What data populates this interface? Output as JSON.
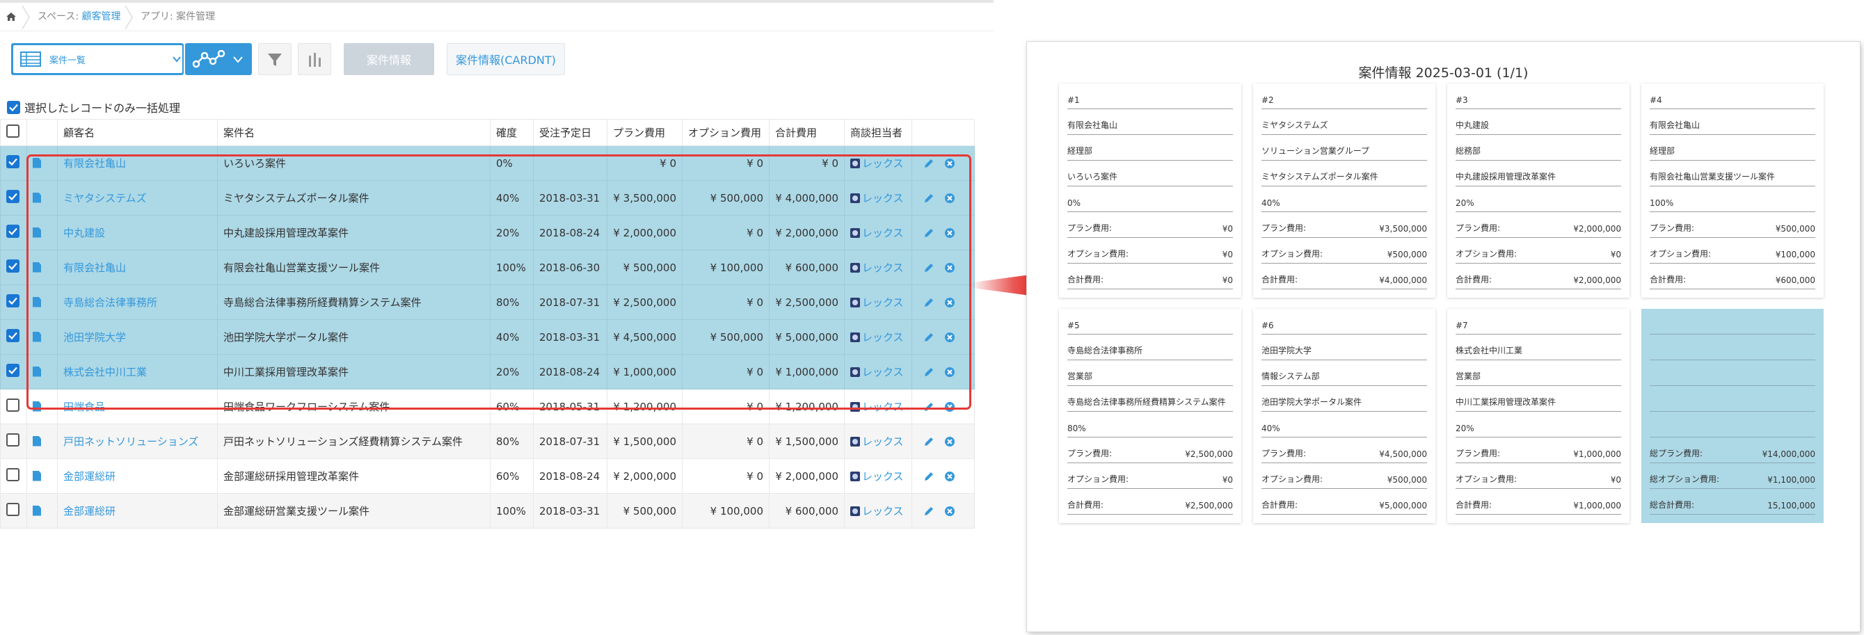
{
  "breadcrumb": {
    "space_prefix": "スペース: ",
    "space_name": "顧客管理",
    "app": "アプリ: 案件管理"
  },
  "toolbar": {
    "view_name": "案件一覧",
    "print_button": "案件情報",
    "print_cardnt_button": "案件情報(CARDNT)"
  },
  "bulk": {
    "label": "選択したレコードのみ一括処理"
  },
  "table": {
    "headers": [
      "",
      "",
      "顧客名",
      "案件名",
      "確度",
      "受注予定日",
      "プラン費用",
      "オプション費用",
      "合計費用",
      "商談担当者",
      ""
    ],
    "rows": [
      {
        "selected": true,
        "customer": "有限会社亀山",
        "deal": "いろいろ案件",
        "prob": "0%",
        "date": "",
        "plan": "¥ 0",
        "option": "¥ 0",
        "total": "¥ 0",
        "staff": "レックス"
      },
      {
        "selected": true,
        "customer": "ミヤタシステムズ",
        "deal": "ミヤタシステムズポータル案件",
        "prob": "40%",
        "date": "2018-03-31",
        "plan": "¥ 3,500,000",
        "option": "¥ 500,000",
        "total": "¥ 4,000,000",
        "staff": "レックス"
      },
      {
        "selected": true,
        "customer": "中丸建設",
        "deal": "中丸建設採用管理改革案件",
        "prob": "20%",
        "date": "2018-08-24",
        "plan": "¥ 2,000,000",
        "option": "¥ 0",
        "total": "¥ 2,000,000",
        "staff": "レックス"
      },
      {
        "selected": true,
        "customer": "有限会社亀山",
        "deal": "有限会社亀山営業支援ツール案件",
        "prob": "100%",
        "date": "2018-06-30",
        "plan": "¥ 500,000",
        "option": "¥ 100,000",
        "total": "¥ 600,000",
        "staff": "レックス"
      },
      {
        "selected": true,
        "customer": "寺島総合法律事務所",
        "deal": "寺島総合法律事務所経費精算システム案件",
        "prob": "80%",
        "date": "2018-07-31",
        "plan": "¥ 2,500,000",
        "option": "¥ 0",
        "total": "¥ 2,500,000",
        "staff": "レックス"
      },
      {
        "selected": true,
        "customer": "池田学院大学",
        "deal": "池田学院大学ポータル案件",
        "prob": "40%",
        "date": "2018-03-31",
        "plan": "¥ 4,500,000",
        "option": "¥ 500,000",
        "total": "¥ 5,000,000",
        "staff": "レックス"
      },
      {
        "selected": true,
        "customer": "株式会社中川工業",
        "deal": "中川工業採用管理改革案件",
        "prob": "20%",
        "date": "2018-08-24",
        "plan": "¥ 1,000,000",
        "option": "¥ 0",
        "total": "¥ 1,000,000",
        "staff": "レックス"
      },
      {
        "selected": false,
        "customer": "田端食品",
        "deal": "田端食品ワークフローシステム案件",
        "prob": "60%",
        "date": "2018-05-31",
        "plan": "¥ 1,200,000",
        "option": "¥ 0",
        "total": "¥ 1,200,000",
        "staff": "レックス"
      },
      {
        "selected": false,
        "customer": "戸田ネットソリューションズ",
        "deal": "戸田ネットソリューションズ経費精算システム案件",
        "prob": "80%",
        "date": "2018-07-31",
        "plan": "¥ 1,500,000",
        "option": "¥ 0",
        "total": "¥ 1,500,000",
        "staff": "レックス"
      },
      {
        "selected": false,
        "customer": "金部運総研",
        "deal": "金部運総研採用管理改革案件",
        "prob": "60%",
        "date": "2018-08-24",
        "plan": "¥ 2,000,000",
        "option": "¥ 0",
        "total": "¥ 2,000,000",
        "staff": "レックス"
      },
      {
        "selected": false,
        "customer": "金部運総研",
        "deal": "金部運総研営業支援ツール案件",
        "prob": "100%",
        "date": "2018-03-31",
        "plan": "¥ 500,000",
        "option": "¥ 100,000",
        "total": "¥ 600,000",
        "staff": "レックス"
      }
    ]
  },
  "preview": {
    "title": "案件情報 2025-03-01 (1/1)",
    "plan_label": "プラン費用:",
    "option_label": "オプション費用:",
    "total_label": "合計費用:",
    "cards": [
      {
        "no": "#1",
        "customer": "有限会社亀山",
        "dept": "経理部",
        "deal": "いろいろ案件",
        "prob": "0%",
        "plan": "¥0",
        "option": "¥0",
        "total": "¥0"
      },
      {
        "no": "#2",
        "customer": "ミヤタシステムズ",
        "dept": "ソリューション営業グループ",
        "deal": "ミヤタシステムズポータル案件",
        "prob": "40%",
        "plan": "¥3,500,000",
        "option": "¥500,000",
        "total": "¥4,000,000"
      },
      {
        "no": "#3",
        "customer": "中丸建設",
        "dept": "総務部",
        "deal": "中丸建設採用管理改革案件",
        "prob": "20%",
        "plan": "¥2,000,000",
        "option": "¥0",
        "total": "¥2,000,000"
      },
      {
        "no": "#4",
        "customer": "有限会社亀山",
        "dept": "経理部",
        "deal": "有限会社亀山営業支援ツール案件",
        "prob": "100%",
        "plan": "¥500,000",
        "option": "¥100,000",
        "total": "¥600,000"
      },
      {
        "no": "#5",
        "customer": "寺島総合法律事務所",
        "dept": "営業部",
        "deal": "寺島総合法律事務所経費精算システム案件",
        "prob": "80%",
        "plan": "¥2,500,000",
        "option": "¥0",
        "total": "¥2,500,000"
      },
      {
        "no": "#6",
        "customer": "池田学院大学",
        "dept": "情報システム部",
        "deal": "池田学院大学ポータル案件",
        "prob": "40%",
        "plan": "¥4,500,000",
        "option": "¥500,000",
        "total": "¥5,000,000"
      },
      {
        "no": "#7",
        "customer": "株式会社中川工業",
        "dept": "営業部",
        "deal": "中川工業採用管理改革案件",
        "prob": "20%",
        "plan": "¥1,000,000",
        "option": "¥0",
        "total": "¥1,000,000"
      }
    ],
    "summary": {
      "plan_label": "総プラン費用:",
      "plan": "¥14,000,000",
      "option_label": "総オプション費用:",
      "option": "¥1,100,000",
      "total_label": "総合計費用:",
      "total": "15,100,000"
    }
  },
  "colors": {
    "accent": "#3498db",
    "selected_row": "#add8e6",
    "highlight_border": "#e53935"
  },
  "icons": [
    "home-icon",
    "table-view-icon",
    "chevron-down-icon",
    "graph-icon",
    "filter-icon",
    "bar-chart-icon",
    "document-icon",
    "user-icon",
    "pencil-icon",
    "delete-icon",
    "arrow-right-icon"
  ]
}
